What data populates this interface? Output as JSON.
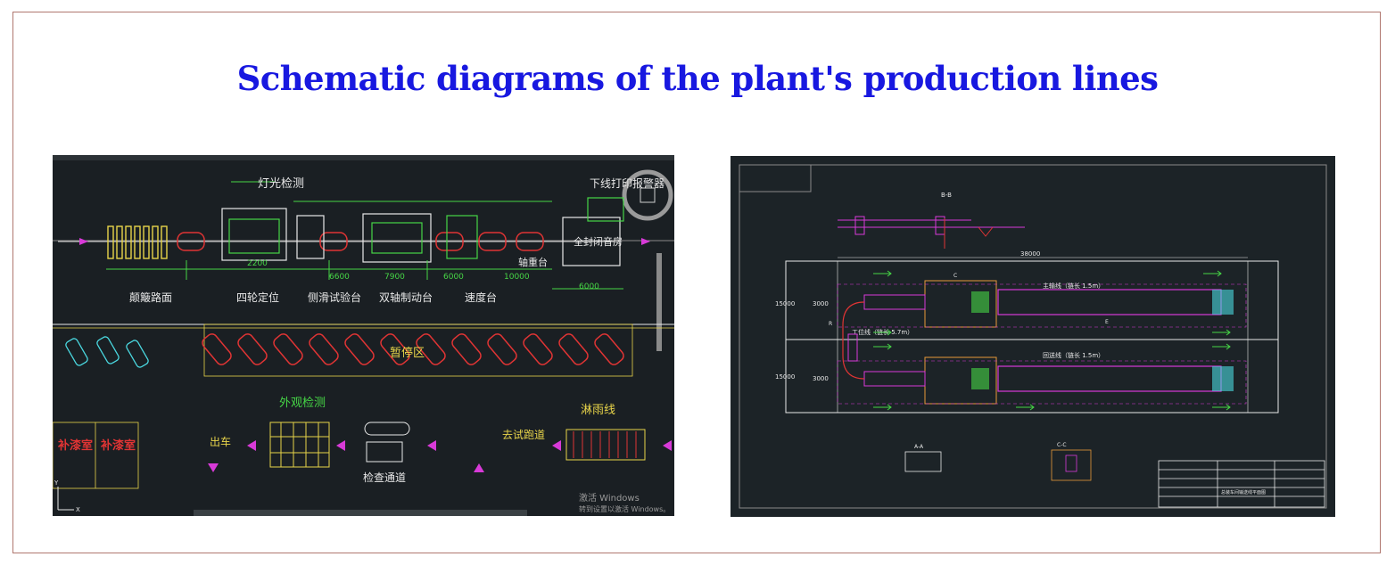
{
  "title": "Schematic diagrams of the plant's production lines",
  "left_drawing": {
    "top_labels": [
      "灯光检测",
      "下线打印报警器"
    ],
    "station_labels": [
      "颠簸路面",
      "四轮定位",
      "侧滑试验台",
      "双轴制动台",
      "速度台"
    ],
    "booth_label": "全封闭音房",
    "axle_label": "轴重台",
    "dimensions": [
      "2200",
      "6600",
      "7900",
      "6000",
      "10000",
      "6000"
    ],
    "middle_label": "暂停区",
    "rooms": [
      "补漆室",
      "补漆室"
    ],
    "lower_labels": [
      "外观检测",
      "淋雨线",
      "去试跑道",
      "出车",
      "检查通道"
    ],
    "watermark_lines": [
      "激活 Windows",
      "转到设置以激活 Windows。"
    ],
    "axis": [
      "Y",
      "X"
    ]
  },
  "right_drawing": {
    "top_label": "B-B",
    "total_length": "38000",
    "width_labels": [
      "15000",
      "3000",
      "15000",
      "3000"
    ],
    "line_labels": [
      "主输线（链长 1.5m）",
      "回送线（链长 1.5m）",
      "工位线（链长 5.7m）"
    ],
    "section_labels": [
      "A-A",
      "C-C"
    ],
    "marker_labels": [
      "R",
      "E",
      "C"
    ],
    "title_block_text": "总装车间输送线平面图"
  },
  "colors": {
    "title": "#1818e0",
    "frame": "#b0776f",
    "cad_bg": "#1a1f23",
    "cad_green": "#46d646",
    "cad_yellow": "#e8d44a",
    "cad_red": "#e03434",
    "cad_magenta": "#d83ad8",
    "cad_white": "#e8e8e8",
    "cad_cyan": "#4ad8e0"
  }
}
